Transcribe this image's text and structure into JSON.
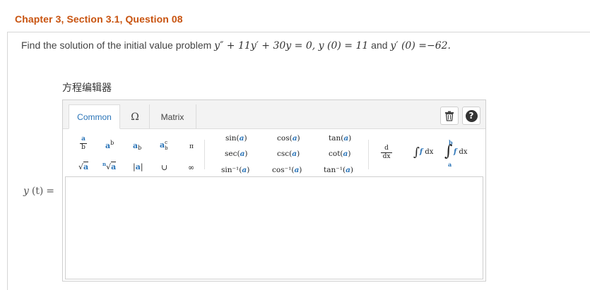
{
  "header": {
    "chapter_title": "Chapter 3, Section 3.1, Question 08"
  },
  "question": {
    "prefix": "Find the solution of the initial value problem ",
    "equation": "y″ + 11y′ + 30y = 0, y (0) = 11",
    "and": " and ",
    "condition2": "y′ (0) =−62."
  },
  "editor": {
    "label": "方程编辑器",
    "tabs": [
      "Common",
      "Ω",
      "Matrix"
    ],
    "active_tab": "Common",
    "accent_color": "#2a74b8",
    "tools": [
      "trash-icon",
      "help-icon"
    ],
    "help_glyph": "?",
    "palette": {
      "fraction": [
        "a",
        "b"
      ],
      "power": [
        "a",
        "b"
      ],
      "subscript": [
        "a",
        "b"
      ],
      "subsup": [
        "a",
        "c",
        "b"
      ],
      "pi": "π",
      "sqrt": "a",
      "nthroot": [
        "n",
        "a"
      ],
      "abs": "a",
      "union": "∪",
      "infinity": "∞",
      "trig": [
        "sin",
        "cos",
        "tan",
        "sec",
        "csc",
        "cot",
        "sin⁻¹",
        "cos⁻¹",
        "tan⁻¹"
      ],
      "trig_arg": "a",
      "derivative": [
        "d",
        "dx"
      ],
      "integral": [
        "f",
        "dx"
      ],
      "definite_integral": [
        "b",
        "f",
        "dx",
        "a"
      ]
    }
  },
  "answer": {
    "label_fn": "y",
    "label_arg": "(t)",
    "label_eq": "="
  }
}
